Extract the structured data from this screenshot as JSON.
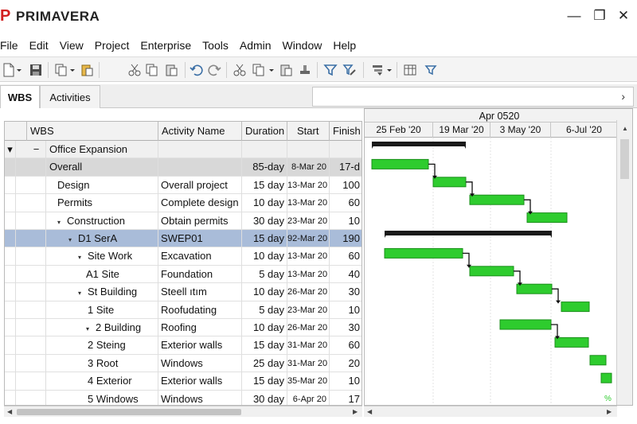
{
  "app": {
    "title": "PRIMAVERA",
    "logo": "P"
  },
  "window_controls": {
    "minimize": "—",
    "maximize": "❐",
    "close": "✕"
  },
  "menu": [
    "File",
    "Edit",
    "View",
    "Project",
    "Enterprise",
    "Tools",
    "Admin",
    "Window",
    "Help"
  ],
  "tabs": {
    "wbs": "WBS",
    "activities": "Activities",
    "scroll_arrow": "›"
  },
  "grid": {
    "headers": {
      "wbs": "WBS",
      "name": "Activity Name",
      "duration": "Duration",
      "start": "Start",
      "finish": "Finish"
    },
    "rows": [
      {
        "type": "summary",
        "ctl1": "▾",
        "ctl2": "−",
        "wbs": "Office Expansion",
        "indent": 0,
        "name": "",
        "duration": "",
        "start": "",
        "finish": ""
      },
      {
        "type": "overall",
        "ctl1": "",
        "ctl2": "",
        "wbs": "Overall",
        "indent": 1,
        "name": "",
        "duration": "85-day",
        "start": "8-Mar 20",
        "finish": "17-d"
      },
      {
        "type": "normal",
        "wbs": "Design",
        "indent": 2,
        "name": "Overall project",
        "duration": "15 day",
        "start": "13-Mar 20",
        "finish": "100"
      },
      {
        "type": "normal",
        "wbs": "Permits",
        "indent": 2,
        "name": "Complete design",
        "duration": "10 day",
        "start": "13-Mar 20",
        "finish": "60"
      },
      {
        "type": "normal",
        "wbs": "Construction",
        "indent": 2,
        "toggle": "▾",
        "name": "Obtain permits",
        "duration": "30 day",
        "start": "23-Mar 20",
        "finish": "10"
      },
      {
        "type": "selected",
        "wbs": "D1 SerA",
        "indent": 3,
        "toggle": "▾",
        "name": "SWEP01",
        "duration": "15 day",
        "start": "92-Mar 20",
        "finish": "190"
      },
      {
        "type": "normal",
        "wbs": "Site Work",
        "indent": 4,
        "toggle": "▾",
        "name": "Excavation",
        "duration": "10 day",
        "start": "13-Mar 20",
        "finish": "60"
      },
      {
        "type": "normal",
        "wbs": "A1 Site",
        "indent": 5,
        "name": "Foundation",
        "duration": "5 day",
        "start": "13-Mar 20",
        "finish": "40"
      },
      {
        "type": "normal",
        "wbs": "St  Building",
        "indent": 4,
        "toggle": "▾",
        "name": "Steell ıtım",
        "duration": "10 day",
        "start": "26-Mar 20",
        "finish": "30"
      },
      {
        "type": "normal",
        "wbs": "1 Site",
        "indent": 6,
        "name": "Roofudating",
        "duration": "5 day",
        "start": "23-Mar 20",
        "finish": "10"
      },
      {
        "type": "normal",
        "wbs": "2 Building",
        "indent": 5,
        "toggle": "▾",
        "name": "Roofing",
        "duration": "10 day",
        "start": "26-Mar 20",
        "finish": "30"
      },
      {
        "type": "normal",
        "wbs": "2 Steing",
        "indent": 6,
        "name": "Exterior walls",
        "duration": "15 day",
        "start": "31-Mar 20",
        "finish": "60"
      },
      {
        "type": "normal",
        "wbs": "3 Root",
        "indent": 6,
        "name": "Windows",
        "duration": "25 day",
        "start": "31-Mar 20",
        "finish": "20"
      },
      {
        "type": "normal",
        "wbs": "4 Exterior",
        "indent": 6,
        "name": "Exterior walls",
        "duration": "15 day",
        "start": "35-Mar 20",
        "finish": "10"
      },
      {
        "type": "normal",
        "wbs": "5 Windows",
        "indent": 6,
        "name": "Windows",
        "duration": "30 day",
        "start": "6-Apr 20",
        "finish": "17"
      }
    ]
  },
  "gantt": {
    "header_top": "Apr 0520",
    "timescale": [
      "25 Feb '20",
      "19 Mar '20",
      "3 May  '20",
      "6-Jul '20"
    ],
    "footer_mark": "%",
    "colors": {
      "summary_bar": "#1a1a1a",
      "task_bar": "#2ecc2e",
      "task_border": "#1a8f1a",
      "link": "#111111",
      "selection": "#a9bcd9"
    }
  }
}
